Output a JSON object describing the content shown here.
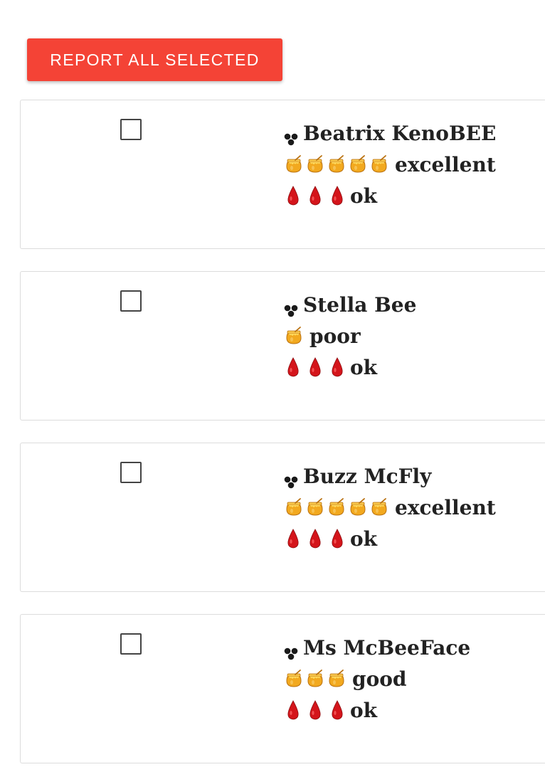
{
  "toolbar": {
    "report_label": "REPORT ALL SELECTED"
  },
  "colors": {
    "report_button": "#f44336",
    "honey": "#f5b82e",
    "blood": "#d4151b"
  },
  "bees": [
    {
      "name": "Beatrix KenoBEE",
      "honey_count": 5,
      "honey_rating": "excellent",
      "blood_count": 3,
      "blood_rating": "ok",
      "selected": false
    },
    {
      "name": "Stella Bee",
      "honey_count": 1,
      "honey_rating": "poor",
      "blood_count": 3,
      "blood_rating": "ok",
      "selected": false
    },
    {
      "name": "Buzz McFly",
      "honey_count": 5,
      "honey_rating": "excellent",
      "blood_count": 3,
      "blood_rating": "ok",
      "selected": false
    },
    {
      "name": "Ms McBeeFace",
      "honey_count": 3,
      "honey_rating": "good",
      "blood_count": 3,
      "blood_rating": "ok",
      "selected": false
    }
  ],
  "icons": {
    "bee": "bee-icon",
    "honey": "honey-pot-icon",
    "blood": "blood-drop-icon"
  }
}
